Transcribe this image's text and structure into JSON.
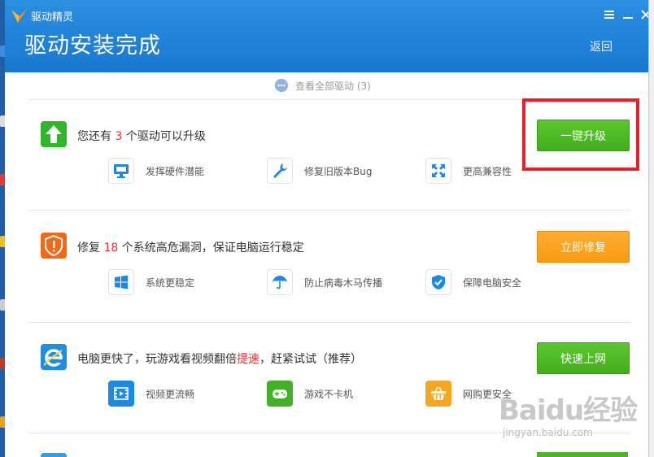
{
  "app": {
    "name": "驱动精灵",
    "page_title": "驱动安装完成",
    "back_label": "返回"
  },
  "view_all": {
    "label": "查看全部驱动 (3)"
  },
  "rows": [
    {
      "title_prefix": "您还有 ",
      "title_highlight": "3",
      "title_suffix": " 个驱动可以升级",
      "button": "一键升级",
      "button_color": "#4cba22",
      "icon": "upgrade-arrow-icon",
      "icon_color": "#2eb829",
      "features": [
        {
          "label": "发挥硬件潜能",
          "icon": "monitor-icon"
        },
        {
          "label": "修复旧版本Bug",
          "icon": "wrench-icon"
        },
        {
          "label": "更高兼容性",
          "icon": "expand-icon"
        }
      ]
    },
    {
      "title_prefix": "修复 ",
      "title_highlight": "18",
      "title_suffix": " 个系统高危漏洞，保证电脑运行稳定",
      "button": "立即修复",
      "button_color": "#f9a11b",
      "icon": "shield-alert-icon",
      "icon_color": "#f06a1a",
      "features": [
        {
          "label": "系统更稳定",
          "icon": "windows-icon"
        },
        {
          "label": "防止病毒木马传播",
          "icon": "umbrella-icon"
        },
        {
          "label": "保障电脑安全",
          "icon": "shield-check-icon"
        }
      ]
    },
    {
      "title_prefix": "电脑更快了，玩游戏看视频翻倍",
      "title_highlight": "提速",
      "title_suffix": "，赶紧试试（推荐）",
      "button": "快速上网",
      "button_color": "#4cba22",
      "icon": "ie-browser-icon",
      "icon_color": "#1e8fe0",
      "features": [
        {
          "label": "视频更流畅",
          "icon": "film-icon"
        },
        {
          "label": "游戏不卡机",
          "icon": "gamepad-icon"
        },
        {
          "label": "网购更安全",
          "icon": "basket-icon"
        }
      ]
    }
  ],
  "watermark": {
    "brand": "Baidu经验",
    "url": "jingyan.baidu.com"
  },
  "colors": {
    "header": "#1e82d8",
    "highlight": "#e8383d",
    "annotation_box": "#ee1c25"
  }
}
